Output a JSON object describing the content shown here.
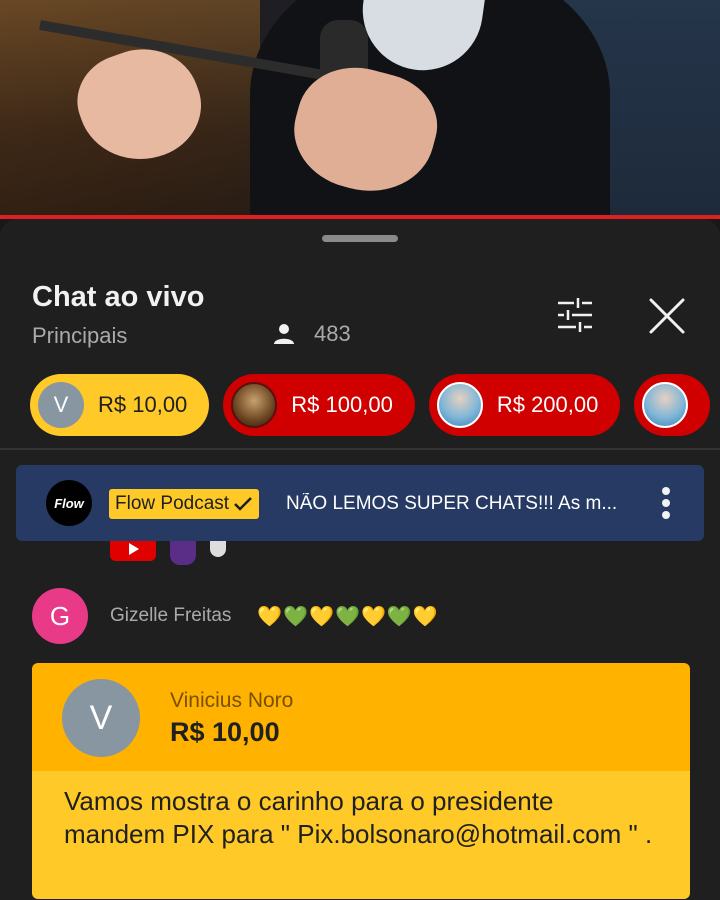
{
  "chat": {
    "title": "Chat ao vivo",
    "mode": "Principais",
    "viewer_count": "483"
  },
  "chips": [
    {
      "avatar_letter": "V",
      "amount": "R$ 10,00",
      "color": "#ffca28"
    },
    {
      "amount": "R$ 100,00",
      "color": "#d00000"
    },
    {
      "amount": "R$ 200,00",
      "color": "#d00000"
    }
  ],
  "pinned": {
    "logo_text": "Flow",
    "channel": "Flow Podcast",
    "message": "NÃO LEMOS SUPER CHATS!!! As m..."
  },
  "message": {
    "avatar_letter": "G",
    "author": "Gizelle Freitas",
    "hearts": "💛💚💛💚💛💚💛"
  },
  "superchat": {
    "avatar_letter": "V",
    "author": "Vinicius Noro",
    "amount": "R$ 10,00",
    "text": "Vamos mostra o carinho para o presidente mandem PIX para \" Pix.bolsonaro@hotmail.com \" ."
  },
  "colors": {
    "accent_red": "#e02020",
    "superchat_yellow": "#ffca28",
    "superchat_header": "#ffb300",
    "pinned_bg": "#263a63"
  }
}
